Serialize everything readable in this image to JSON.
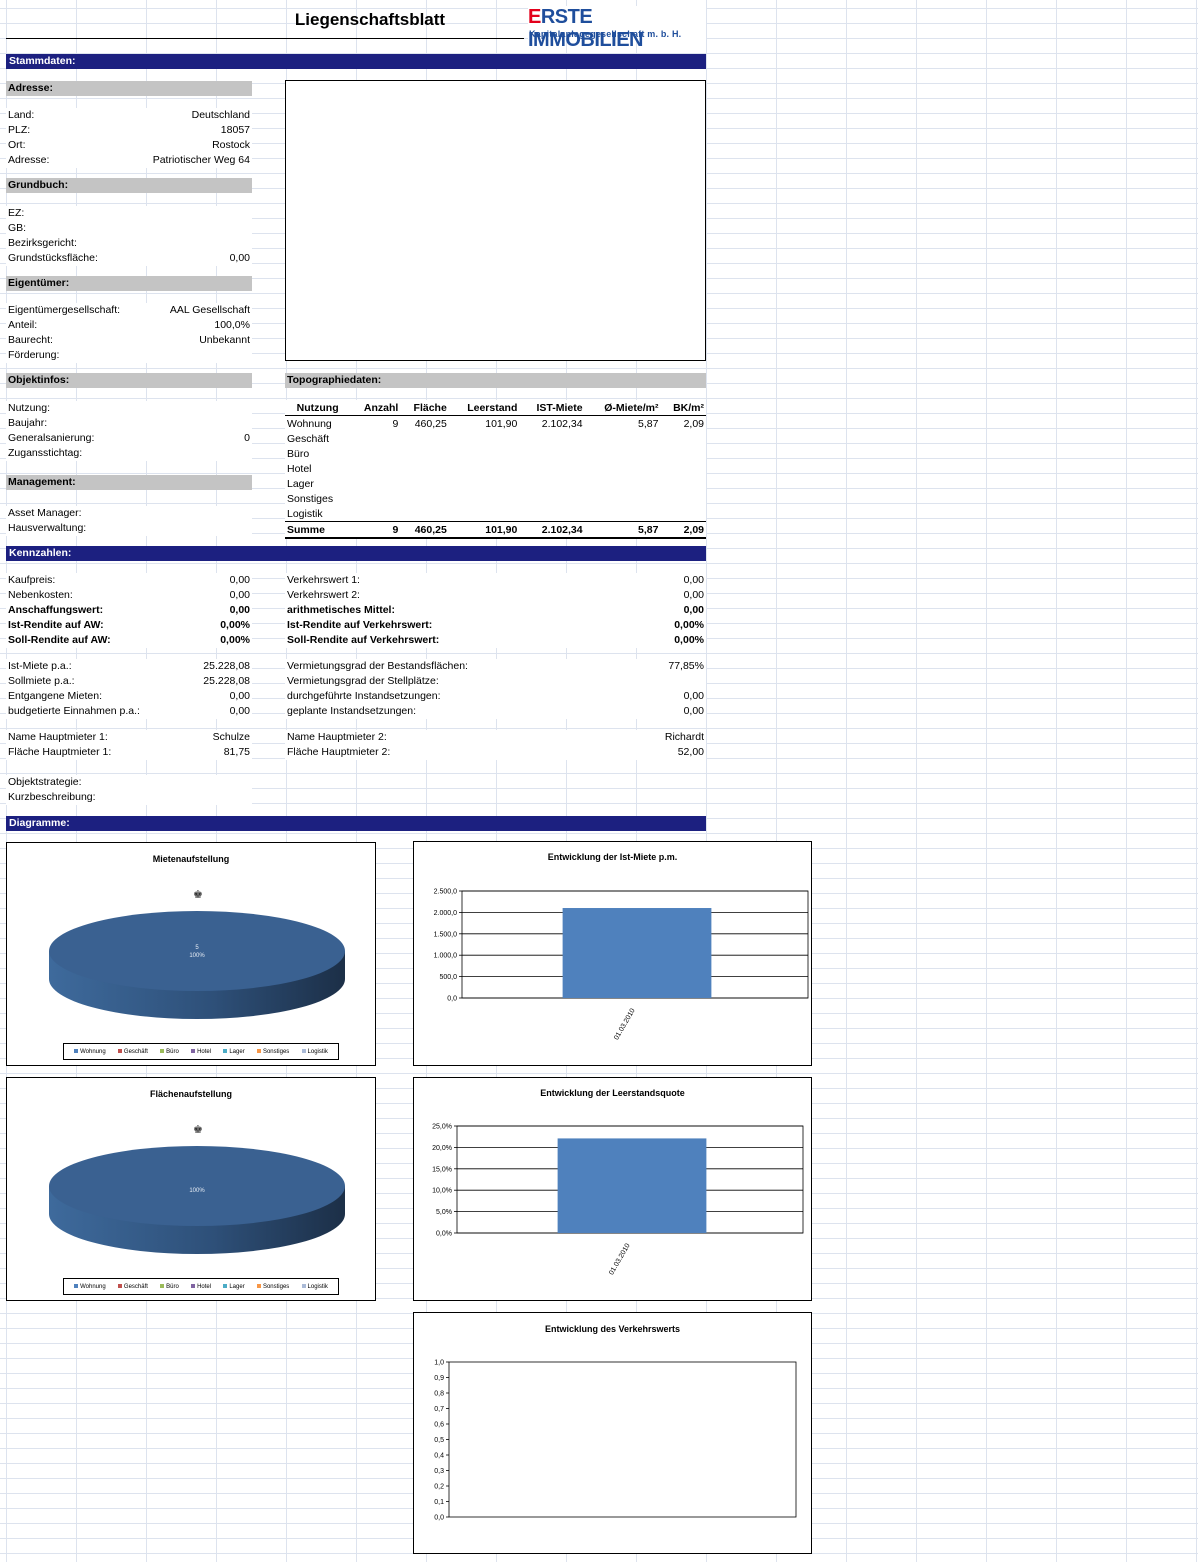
{
  "header": {
    "title": "Liegenschaftsblatt",
    "logo_main": "ERSTE IMMOBILIEN",
    "logo_sub": "Kapitalanlagegesellschaft m. b. H."
  },
  "sections": {
    "stammdaten": "Stammdaten:",
    "kennzahlen": "Kennzahlen:",
    "diagramme": "Diagramme:"
  },
  "adresse": {
    "heading": "Adresse:",
    "land_label": "Land:",
    "land": "Deutschland",
    "plz_label": "PLZ:",
    "plz": "18057",
    "ort_label": "Ort:",
    "ort": "Rostock",
    "adresse_label": "Adresse:",
    "adresse": "Patriotischer Weg 64"
  },
  "grundbuch": {
    "heading": "Grundbuch:",
    "ez_label": "EZ:",
    "gb_label": "GB:",
    "bezirksgericht_label": "Bezirksgericht:",
    "grundstuecksflaeche_label": "Grundstücksfläche:",
    "grundstuecksflaeche": "0,00"
  },
  "eigentuemer": {
    "heading": "Eigentümer:",
    "gesellschaft_label": "Eigentümergesellschaft:",
    "gesellschaft": "AAL Gesellschaft",
    "anteil_label": "Anteil:",
    "anteil": "100,0%",
    "baurecht_label": "Baurecht:",
    "baurecht": "Unbekannt",
    "foerderung_label": "Förderung:"
  },
  "objektinfos": {
    "heading": "Objektinfos:",
    "nutzung_label": "Nutzung:",
    "baujahr_label": "Baujahr:",
    "generalsanierung_label": "Generalsanierung:",
    "generalsanierung": "0",
    "zugangsstichtag_label": "Zugansstichtag:"
  },
  "management": {
    "heading": "Management:",
    "asset_manager_label": "Asset Manager:",
    "hausverwaltung_label": "Hausverwaltung:"
  },
  "topographie": {
    "heading": "Topographiedaten:",
    "columns": [
      "Nutzung",
      "Anzahl",
      "Fläche",
      "Leerstand",
      "IST-Miete",
      "Ø-Miete/m²",
      "BK/m²"
    ],
    "rows": [
      [
        "Wohnung",
        "9",
        "460,25",
        "101,90",
        "2.102,34",
        "5,87",
        "2,09"
      ],
      [
        "Geschäft",
        "",
        "",
        "",
        "",
        "",
        ""
      ],
      [
        "Büro",
        "",
        "",
        "",
        "",
        "",
        ""
      ],
      [
        "Hotel",
        "",
        "",
        "",
        "",
        "",
        ""
      ],
      [
        "Lager",
        "",
        "",
        "",
        "",
        "",
        ""
      ],
      [
        "Sonstiges",
        "",
        "",
        "",
        "",
        "",
        ""
      ],
      [
        "Logistik",
        "",
        "",
        "",
        "",
        "",
        ""
      ]
    ],
    "sum": [
      "Summe",
      "9",
      "460,25",
      "101,90",
      "2.102,34",
      "5,87",
      "2,09"
    ]
  },
  "kennzahlen": {
    "left": [
      {
        "label": "Kaufpreis:",
        "value": "0,00",
        "bold": false
      },
      {
        "label": "Nebenkosten:",
        "value": "0,00",
        "bold": false
      },
      {
        "label": "Anschaffungswert:",
        "value": "0,00",
        "bold": true
      },
      {
        "label": "Ist-Rendite auf AW:",
        "value": "0,00%",
        "bold": true
      },
      {
        "label": "Soll-Rendite auf AW:",
        "value": "0,00%",
        "bold": true
      }
    ],
    "right": [
      {
        "label": "Verkehrswert 1:",
        "value": "0,00",
        "bold": false
      },
      {
        "label": "Verkehrswert 2:",
        "value": "0,00",
        "bold": false
      },
      {
        "label": "arithmetisches Mittel:",
        "value": "0,00",
        "bold": true
      },
      {
        "label": "Ist-Rendite auf Verkehrswert:",
        "value": "0,00%",
        "bold": true
      },
      {
        "label": "Soll-Rendite auf Verkehrswert:",
        "value": "0,00%",
        "bold": true
      }
    ],
    "left2": [
      {
        "label": "Ist-Miete p.a.:",
        "value": "25.228,08"
      },
      {
        "label": "Sollmiete p.a.:",
        "value": "25.228,08"
      },
      {
        "label": "Entgangene Mieten:",
        "value": "0,00"
      },
      {
        "label": "budgetierte Einnahmen p.a.:",
        "value": "0,00"
      }
    ],
    "right2": [
      {
        "label": "Vermietungsgrad der Bestandsflächen:",
        "value": "77,85%"
      },
      {
        "label": "Vermietungsgrad der Stellplätze:",
        "value": ""
      },
      {
        "label": "durchgeführte Instandsetzungen:",
        "value": "0,00"
      },
      {
        "label": "geplante Instandsetzungen:",
        "value": "0,00"
      }
    ],
    "hauptmieter_left": [
      {
        "label": "Name Hauptmieter 1:",
        "value": "Schulze"
      },
      {
        "label": "Fläche Hauptmieter 1:",
        "value": "81,75"
      }
    ],
    "hauptmieter_right": [
      {
        "label": "Name Hauptmieter 2:",
        "value": "Richardt"
      },
      {
        "label": "Fläche Hauptmieter 2:",
        "value": "52,00"
      }
    ],
    "objektstrategie_label": "Objektstrategie:",
    "kurzbeschreibung_label": "Kurzbeschreibung:"
  },
  "legend_items": [
    {
      "name": "Wohnung",
      "color": "#4f81bd"
    },
    {
      "name": "Geschäft",
      "color": "#c0504d"
    },
    {
      "name": "Büro",
      "color": "#9bbb59"
    },
    {
      "name": "Hotel",
      "color": "#8064a2"
    },
    {
      "name": "Lager",
      "color": "#4bacc6"
    },
    {
      "name": "Sonstiges",
      "color": "#f79646"
    },
    {
      "name": "Logistik",
      "color": "#aabad7"
    }
  ],
  "chart_data": [
    {
      "type": "pie",
      "title": "Mietenaufstellung",
      "slices": [
        {
          "name": "Wohnung",
          "value": 100
        }
      ],
      "label_value": "5",
      "label_percent": "100%",
      "color": "#3a6191"
    },
    {
      "type": "pie",
      "title": "Flächenaufstellung",
      "slices": [
        {
          "name": "Wohnung",
          "value": 100
        }
      ],
      "label_percent": "100%",
      "color": "#3a6191"
    },
    {
      "type": "bar",
      "title": "Entwicklung der Ist-Miete p.m.",
      "categories": [
        "01.03.2010"
      ],
      "values": [
        2102.34
      ],
      "ylim": [
        0,
        2500
      ],
      "yticks": [
        "0,0",
        "500,0",
        "1.000,0",
        "1.500,0",
        "2.000,0",
        "2.500,0"
      ],
      "color": "#4f81bd"
    },
    {
      "type": "bar",
      "title": "Entwicklung der Leerstandsquote",
      "categories": [
        "01.03.2010"
      ],
      "values": [
        22.1
      ],
      "ylim": [
        0,
        25
      ],
      "yticks": [
        "0,0%",
        "5,0%",
        "10,0%",
        "15,0%",
        "20,0%",
        "25,0%"
      ],
      "color": "#4f81bd"
    },
    {
      "type": "line",
      "title": "Entwicklung des Verkehrswerts",
      "values": [],
      "ylim": [
        0,
        1
      ],
      "yticks": [
        "0,0",
        "0,1",
        "0,2",
        "0,3",
        "0,4",
        "0,5",
        "0,6",
        "0,7",
        "0,8",
        "0,9",
        "1,0"
      ]
    }
  ]
}
